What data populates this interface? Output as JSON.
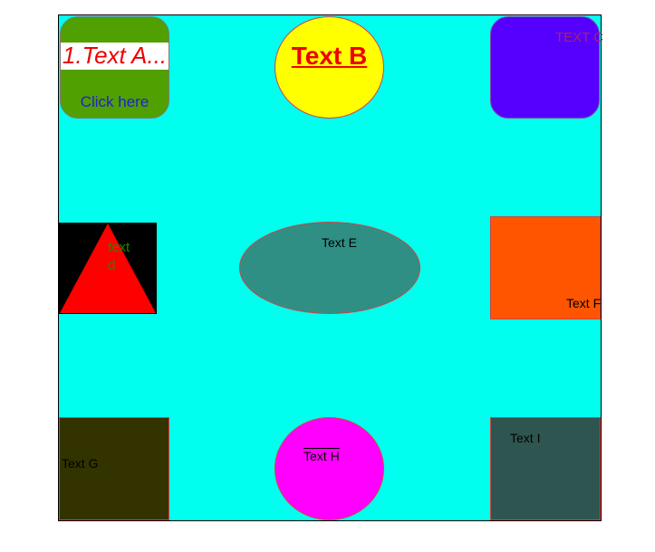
{
  "canvas": {
    "background": "#00ffee"
  },
  "shapes": {
    "a": {
      "title": "1.Text A...",
      "link": "Click here",
      "color": "#4fa000"
    },
    "b": {
      "label": "Text B",
      "color": "#ffff00"
    },
    "c": {
      "label": "TEXT C",
      "color": "#5500ff"
    },
    "d": {
      "label": "text d",
      "color": "#ff0000"
    },
    "e": {
      "label": "Text E",
      "color": "#2f8f84"
    },
    "f": {
      "label": "Text F",
      "color": "#ff5500"
    },
    "g": {
      "label": "Text G",
      "color": "#333300"
    },
    "h": {
      "label": "Text H",
      "color": "#ff00ff"
    },
    "i": {
      "label": "Text I",
      "color": "#2f5550"
    }
  }
}
